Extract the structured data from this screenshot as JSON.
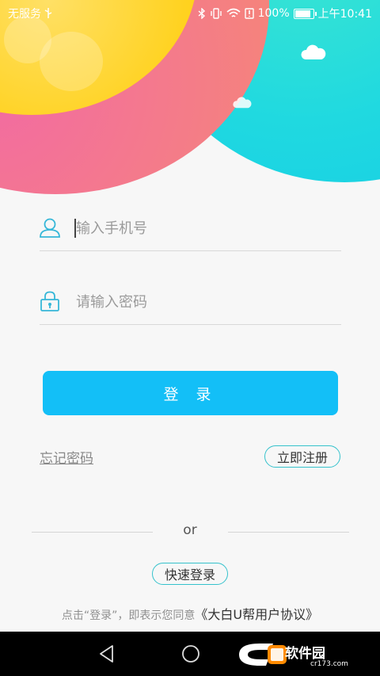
{
  "status_bar": {
    "carrier": "无服务",
    "battery": "100%",
    "battery_level": 1.0,
    "time": "上午10:41"
  },
  "form": {
    "phone_placeholder": "输入手机号",
    "password_placeholder": "请输入密码",
    "login_button": "登 录",
    "forgot_password": "忘记密码",
    "register_button": "立即注册",
    "divider_text": "or",
    "quick_login_button": "快速登录",
    "agreement_prefix": "点击“登录”，即表示您同意",
    "agreement_link": "《大白U帮用户协议》"
  },
  "watermark": {
    "name": "软件园",
    "url": "cr173.com"
  },
  "colors": {
    "accent": "#13bff7",
    "outline": "#35c2cc",
    "icon": "#36b7d8"
  }
}
